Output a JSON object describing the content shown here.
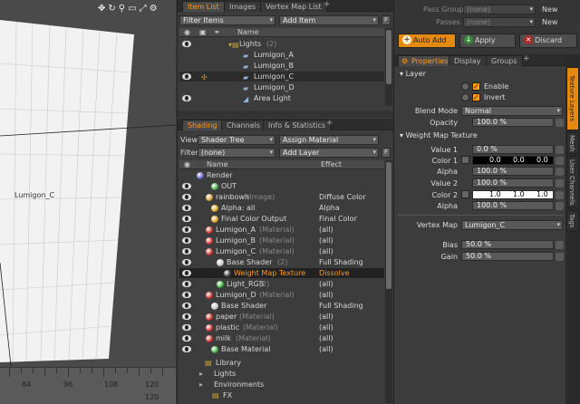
{
  "viewport": {
    "object_label": "Lumigon_C",
    "ruler_labels": [
      "84",
      "96",
      "108",
      "120"
    ],
    "toolbar_icons": [
      "move-icon",
      "rotate-icon",
      "search-icon",
      "scale-icon",
      "fit-icon",
      "settings-icon"
    ]
  },
  "item_list": {
    "tabs": [
      "Item List",
      "Images",
      "Vertex Map List"
    ],
    "filter": "Filter Items",
    "add": "Add Item",
    "f_btn": "F",
    "col_name": "Name",
    "rows": [
      {
        "label": "Lights",
        "sub": "(2)"
      },
      {
        "label": "Lumigon_A",
        "sub": ""
      },
      {
        "label": "Lumigon_B",
        "sub": ""
      },
      {
        "label": "Lumigon_C",
        "sub": ""
      },
      {
        "label": "Lumigon_D",
        "sub": ""
      },
      {
        "label": "Area Light",
        "sub": ""
      }
    ]
  },
  "shading": {
    "tabs": [
      "Shading",
      "Channels",
      "Info & Statistics"
    ],
    "view_label": "View",
    "view_value": "Shader Tree",
    "assign": "Assign Material",
    "filter_label": "Filter",
    "filter_value": "(none)",
    "add_layer": "Add Layer",
    "f_btn": "F",
    "col_name": "Name",
    "col_effect": "Effect",
    "rows": [
      {
        "label": "Render",
        "sub": "",
        "effect": ""
      },
      {
        "label": "OUT",
        "sub": "",
        "effect": ""
      },
      {
        "label": "rainbowh",
        "sub": "(Image)",
        "effect": "Diffuse Color"
      },
      {
        "label": "Alpha: all",
        "sub": "",
        "effect": "Alpha"
      },
      {
        "label": "Final Color Output",
        "sub": "",
        "effect": "Final Color"
      },
      {
        "label": "Lumigon_A",
        "sub": "(Material)",
        "effect": "(all)"
      },
      {
        "label": "Lumigon_B",
        "sub": "(Material)",
        "effect": "(all)"
      },
      {
        "label": "Lumigon_C",
        "sub": "(Material)",
        "effect": "(all)"
      },
      {
        "label": "Base Shader",
        "sub": "(2)",
        "effect": "Full Shading"
      },
      {
        "label": "Weight Map Texture",
        "sub": "",
        "effect": "Dissolve"
      },
      {
        "label": "Light_RGB",
        "sub": "(2)",
        "effect": "(all)"
      },
      {
        "label": "Lumigon_D",
        "sub": "(Material)",
        "effect": "(all)"
      },
      {
        "label": "Base Shader",
        "sub": "",
        "effect": "Full Shading"
      },
      {
        "label": "paper",
        "sub": "(Material)",
        "effect": "(all)"
      },
      {
        "label": "plastic",
        "sub": "(Material)",
        "effect": "(all)"
      },
      {
        "label": "milk",
        "sub": "(Material)",
        "effect": "(all)"
      },
      {
        "label": "Base Material",
        "sub": "",
        "effect": "(all)"
      }
    ],
    "bottom": [
      "Library",
      "Lights",
      "Environments",
      "FX"
    ]
  },
  "top_bar": {
    "pass_groups": "Pass Groups",
    "pass_groups_value": "(none)",
    "new1": "New",
    "passes": "Passes",
    "passes_value": "(none)",
    "new2": "New",
    "auto_add": "Auto Add",
    "apply": "Apply",
    "discard": "Discard"
  },
  "properties": {
    "tabs": [
      "Properties",
      "Display",
      "Groups"
    ],
    "layer_section": "Layer",
    "enable": "Enable",
    "invert": "Invert",
    "blend_label": "Blend Mode",
    "blend_value": "Normal",
    "opacity_label": "Opacity",
    "opacity_value": "100.0 %",
    "wmt_section": "Weight Map Texture",
    "value1_label": "Value 1",
    "value1": "0.0 %",
    "color1_label": "Color 1",
    "color1": [
      "0.0",
      "0.0",
      "0.0"
    ],
    "alpha1_label": "Alpha",
    "alpha1": "100.0 %",
    "value2_label": "Value 2",
    "value2": "100.0 %",
    "color2_label": "Color 2",
    "color2": [
      "1.0",
      "1.0",
      "1.0"
    ],
    "alpha2_label": "Alpha",
    "alpha2": "100.0 %",
    "vmap_label": "Vertex Map",
    "vmap_value": "Lumigon_C",
    "bias_label": "Bias",
    "bias": "50.0 %",
    "gain_label": "Gain",
    "gain": "50.0 %",
    "vtabs": [
      "Texture Layers",
      "Mesh",
      "User Channels",
      "Tags"
    ]
  },
  "colors": {
    "accent": "#ff9a1a",
    "selected": "#5a5a5a"
  }
}
